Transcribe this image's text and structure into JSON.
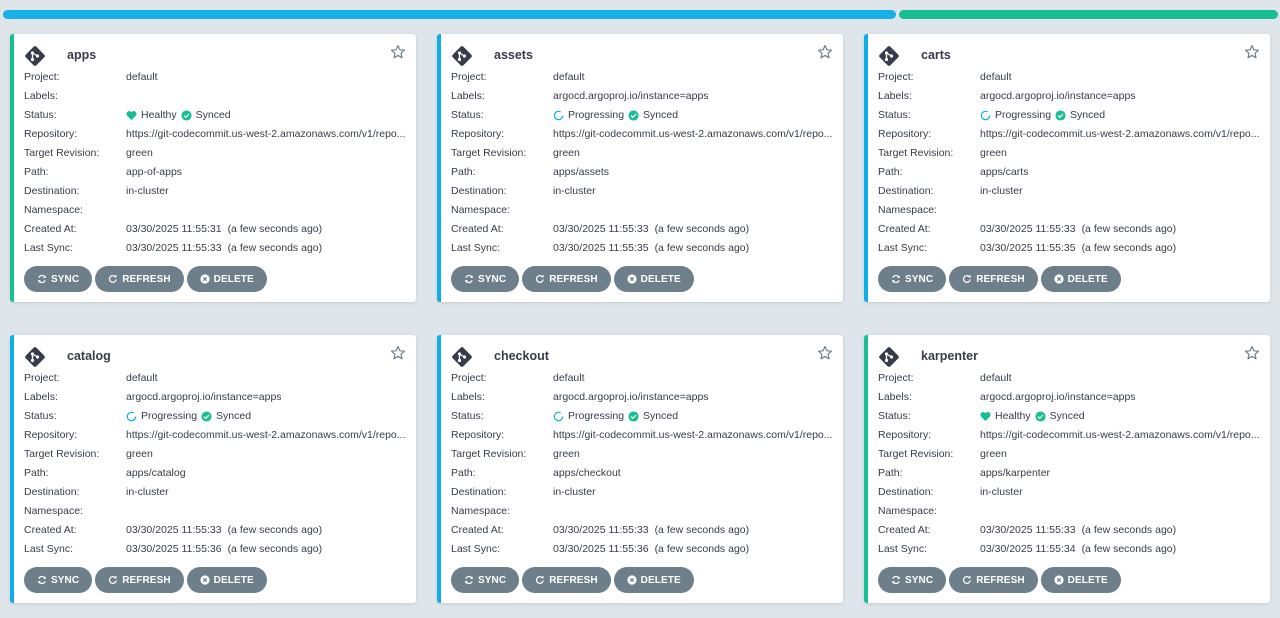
{
  "labels": {
    "project": "Project:",
    "labels": "Labels:",
    "status": "Status:",
    "repository": "Repository:",
    "target_revision": "Target Revision:",
    "path": "Path:",
    "destination": "Destination:",
    "namespace": "Namespace:",
    "created_at": "Created At:",
    "last_sync": "Last Sync:"
  },
  "buttons": {
    "sync": "SYNC",
    "refresh": "REFRESH",
    "delete": "DELETE"
  },
  "colors": {
    "healthy": "#18be94",
    "progressing": "#0dadea",
    "synced": "#18be94",
    "button": "#6d7f8b"
  },
  "apps": [
    {
      "name": "apps",
      "project": "default",
      "labels": "",
      "health": "Healthy",
      "health_icon": "heart-icon",
      "sync_status": "Synced",
      "repository": "https://git-codecommit.us-west-2.amazonaws.com/v1/repo...",
      "target_revision": "green",
      "path": "app-of-apps",
      "destination": "in-cluster",
      "namespace": "",
      "created_at": "03/30/2025 11:55:31",
      "created_ago": "(a few seconds ago)",
      "last_sync": "03/30/2025 11:55:33",
      "last_sync_ago": "(a few seconds ago)"
    },
    {
      "name": "assets",
      "project": "default",
      "labels": "argocd.argoproj.io/instance=apps",
      "health": "Progressing",
      "health_icon": "spinner-icon",
      "sync_status": "Synced",
      "repository": "https://git-codecommit.us-west-2.amazonaws.com/v1/repo...",
      "target_revision": "green",
      "path": "apps/assets",
      "destination": "in-cluster",
      "namespace": "",
      "created_at": "03/30/2025 11:55:33",
      "created_ago": "(a few seconds ago)",
      "last_sync": "03/30/2025 11:55:35",
      "last_sync_ago": "(a few seconds ago)"
    },
    {
      "name": "carts",
      "project": "default",
      "labels": "argocd.argoproj.io/instance=apps",
      "health": "Progressing",
      "health_icon": "spinner-icon",
      "sync_status": "Synced",
      "repository": "https://git-codecommit.us-west-2.amazonaws.com/v1/repo...",
      "target_revision": "green",
      "path": "apps/carts",
      "destination": "in-cluster",
      "namespace": "",
      "created_at": "03/30/2025 11:55:33",
      "created_ago": "(a few seconds ago)",
      "last_sync": "03/30/2025 11:55:35",
      "last_sync_ago": "(a few seconds ago)"
    },
    {
      "name": "catalog",
      "project": "default",
      "labels": "argocd.argoproj.io/instance=apps",
      "health": "Progressing",
      "health_icon": "spinner-icon",
      "sync_status": "Synced",
      "repository": "https://git-codecommit.us-west-2.amazonaws.com/v1/repo...",
      "target_revision": "green",
      "path": "apps/catalog",
      "destination": "in-cluster",
      "namespace": "",
      "created_at": "03/30/2025 11:55:33",
      "created_ago": "(a few seconds ago)",
      "last_sync": "03/30/2025 11:55:36",
      "last_sync_ago": "(a few seconds ago)"
    },
    {
      "name": "checkout",
      "project": "default",
      "labels": "argocd.argoproj.io/instance=apps",
      "health": "Progressing",
      "health_icon": "spinner-icon",
      "sync_status": "Synced",
      "repository": "https://git-codecommit.us-west-2.amazonaws.com/v1/repo...",
      "target_revision": "green",
      "path": "apps/checkout",
      "destination": "in-cluster",
      "namespace": "",
      "created_at": "03/30/2025 11:55:33",
      "created_ago": "(a few seconds ago)",
      "last_sync": "03/30/2025 11:55:36",
      "last_sync_ago": "(a few seconds ago)"
    },
    {
      "name": "karpenter",
      "project": "default",
      "labels": "argocd.argoproj.io/instance=apps",
      "health": "Healthy",
      "health_icon": "heart-icon",
      "sync_status": "Synced",
      "repository": "https://git-codecommit.us-west-2.amazonaws.com/v1/repo...",
      "target_revision": "green",
      "path": "apps/karpenter",
      "destination": "in-cluster",
      "namespace": "",
      "created_at": "03/30/2025 11:55:33",
      "created_ago": "(a few seconds ago)",
      "last_sync": "03/30/2025 11:55:34",
      "last_sync_ago": "(a few seconds ago)"
    }
  ]
}
